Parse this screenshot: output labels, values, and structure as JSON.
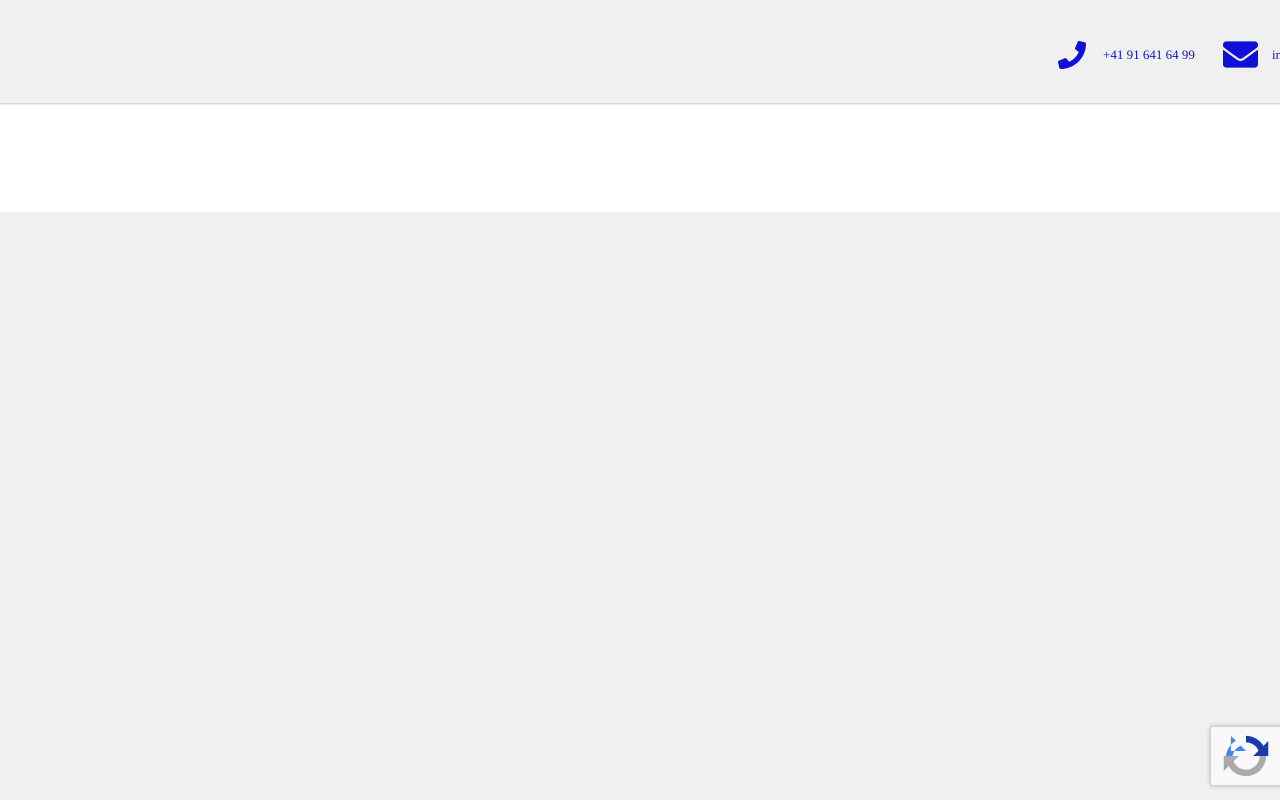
{
  "header": {
    "phone": {
      "icon": "phone-icon",
      "text": "+41 91 641 64 99"
    },
    "email": {
      "icon": "envelope-icon",
      "text": "in"
    }
  },
  "recaptcha": {
    "icon": "recaptcha-logo-icon"
  },
  "colors": {
    "accent": "#1010d8",
    "page_background": "#f0f0f1",
    "nav_background": "#ffffff"
  }
}
